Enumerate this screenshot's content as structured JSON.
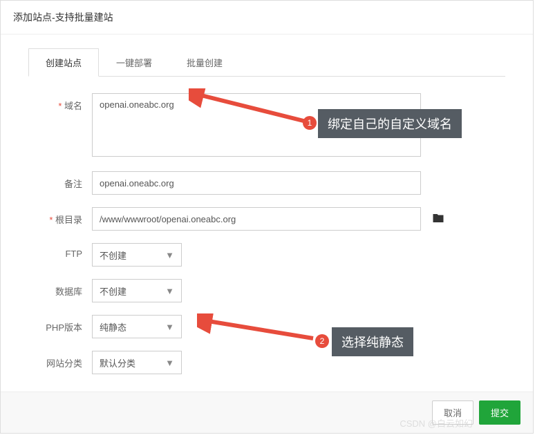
{
  "header": {
    "title": "添加站点-支持批量建站"
  },
  "tabs": [
    {
      "label": "创建站点",
      "active": true
    },
    {
      "label": "一键部署",
      "active": false
    },
    {
      "label": "批量创建",
      "active": false
    }
  ],
  "form": {
    "domain": {
      "label": "域名",
      "value": "openai.oneabc.org"
    },
    "remark": {
      "label": "备注",
      "value": "openai.oneabc.org"
    },
    "root": {
      "label": "根目录",
      "value": "/www/wwwroot/openai.oneabc.org"
    },
    "ftp": {
      "label": "FTP",
      "value": "不创建"
    },
    "db": {
      "label": "数据库",
      "value": "不创建"
    },
    "php": {
      "label": "PHP版本",
      "value": "纯静态"
    },
    "cat": {
      "label": "网站分类",
      "value": "默认分类"
    }
  },
  "footer": {
    "cancel": "取消",
    "submit": "提交"
  },
  "callouts": {
    "c1": {
      "badge": "1",
      "text": "绑定自己的自定义域名"
    },
    "c2": {
      "badge": "2",
      "text": "选择纯静态"
    }
  },
  "watermark": "CSDN @白云如幻"
}
